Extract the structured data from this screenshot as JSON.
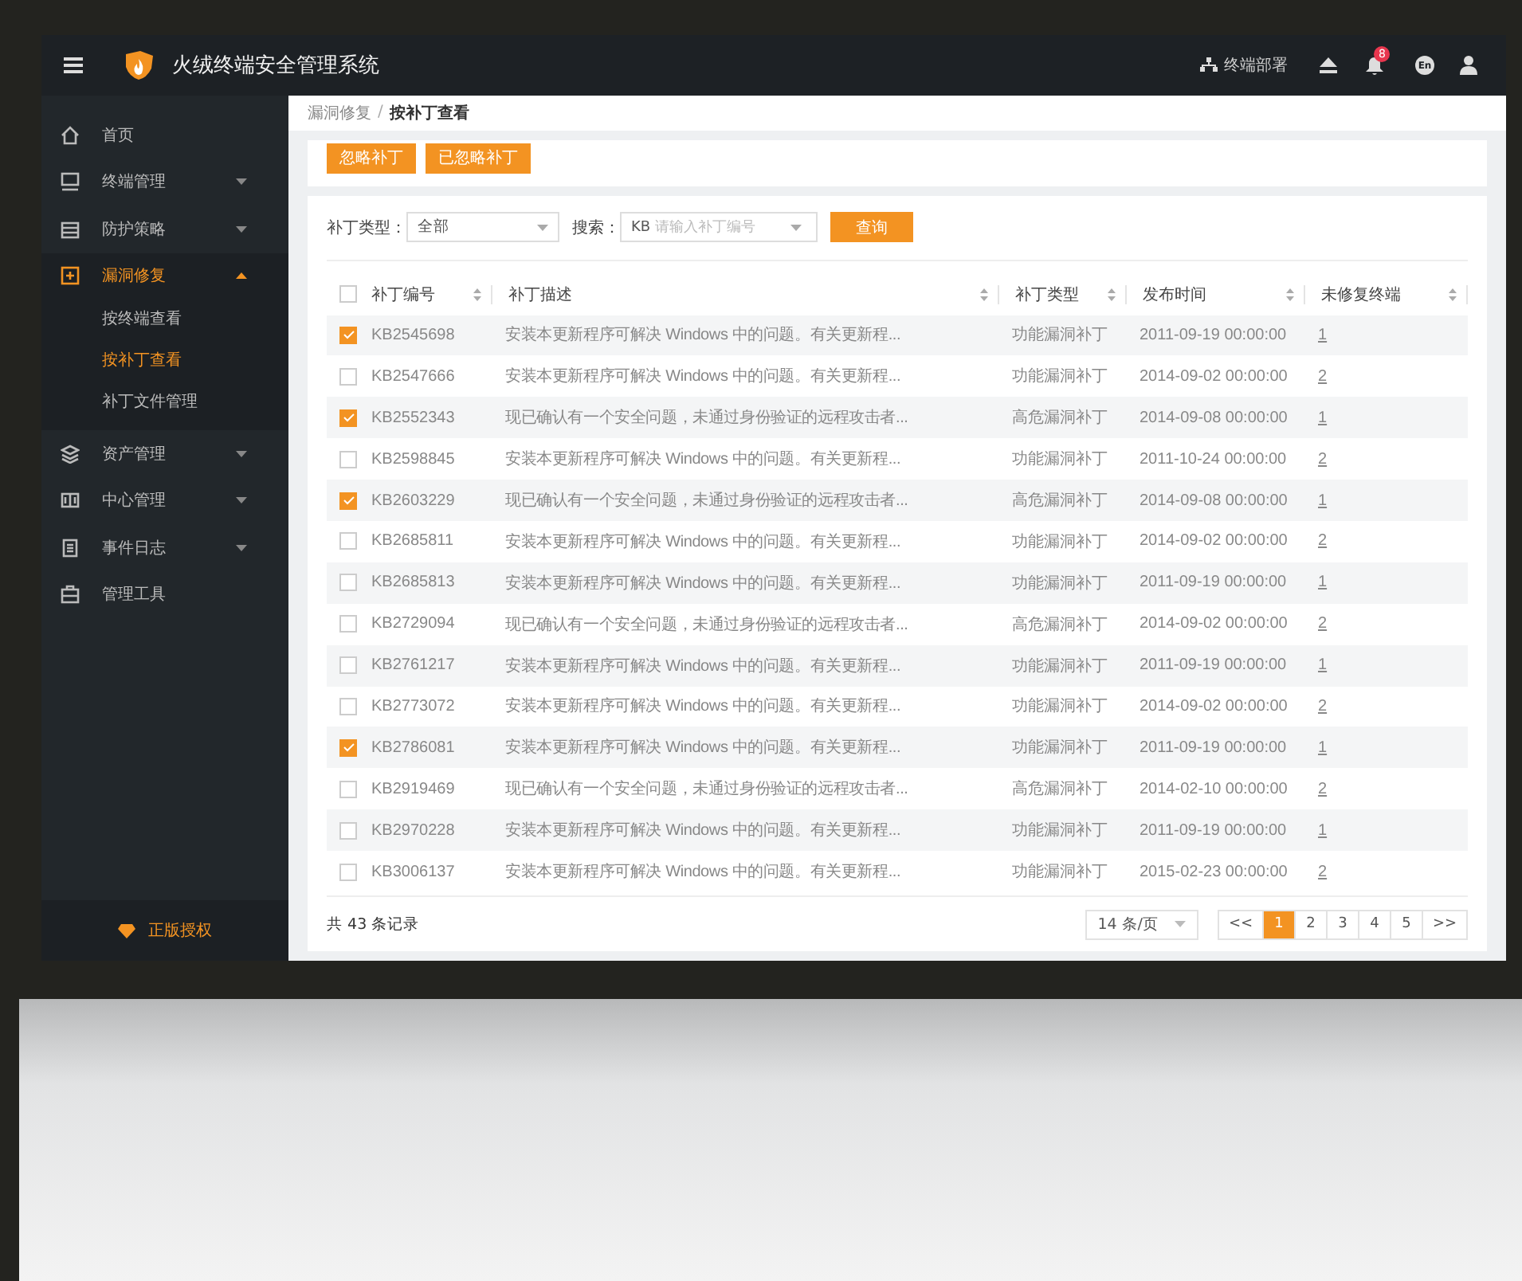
{
  "header": {
    "title": "火绒终端安全管理系统",
    "deploy": "终端部署",
    "notifications": "8",
    "language": "En"
  },
  "sidebar": {
    "items": [
      {
        "label": "首页",
        "expandable": false,
        "selected": false
      },
      {
        "label": "终端管理",
        "expandable": true,
        "expanded": false,
        "selected": false
      },
      {
        "label": "防护策略",
        "expandable": true,
        "expanded": false,
        "selected": false
      },
      {
        "label": "漏洞修复",
        "expandable": true,
        "expanded": true,
        "selected": true,
        "children": [
          {
            "label": "按终端查看",
            "selected": false
          },
          {
            "label": "按补丁查看",
            "selected": true
          },
          {
            "label": "补丁文件管理",
            "selected": false
          }
        ]
      },
      {
        "label": "资产管理",
        "expandable": true,
        "expanded": false,
        "selected": false
      },
      {
        "label": "中心管理",
        "expandable": true,
        "expanded": false,
        "selected": false
      },
      {
        "label": "事件日志",
        "expandable": true,
        "expanded": false,
        "selected": false
      },
      {
        "label": "管理工具",
        "expandable": false,
        "selected": false
      }
    ],
    "footer": "正版授权"
  },
  "breadcrumb": {
    "items": [
      "漏洞修复",
      "按补丁查看"
    ],
    "separator": "/"
  },
  "actions": [
    "忽略补丁",
    "已忽略补丁"
  ],
  "filters": {
    "type_label": "补丁类型：",
    "type_value": "全部",
    "search_label": "搜索：",
    "search_prefix": "KB",
    "search_placeholder": "请输入补丁编号",
    "query": "查询"
  },
  "table": {
    "all_checked": false,
    "columns": [
      "补丁编号",
      "补丁描述",
      "补丁类型",
      "发布时间",
      "未修复终端"
    ],
    "rows": [
      {
        "checked": true,
        "cells": [
          "KB2545698",
          "安装本更新程序可解决 Windows 中的问题。有关更新程...",
          "功能漏洞补丁",
          "2011-09-19 00:00:00",
          "1"
        ]
      },
      {
        "checked": false,
        "cells": [
          "KB2547666",
          "安装本更新程序可解决 Windows 中的问题。有关更新程...",
          "功能漏洞补丁",
          "2014-09-02 00:00:00",
          "2"
        ]
      },
      {
        "checked": true,
        "cells": [
          "KB2552343",
          "现已确认有一个安全问题，未通过身份验证的远程攻击者...",
          "高危漏洞补丁",
          "2014-09-08 00:00:00",
          "1"
        ]
      },
      {
        "checked": false,
        "cells": [
          "KB2598845",
          "安装本更新程序可解决 Windows 中的问题。有关更新程...",
          "功能漏洞补丁",
          "2011-10-24 00:00:00",
          "2"
        ]
      },
      {
        "checked": true,
        "cells": [
          "KB2603229",
          "现已确认有一个安全问题，未通过身份验证的远程攻击者...",
          "高危漏洞补丁",
          "2014-09-08 00:00:00",
          "1"
        ]
      },
      {
        "checked": false,
        "cells": [
          "KB2685811",
          "安装本更新程序可解决 Windows 中的问题。有关更新程...",
          "功能漏洞补丁",
          "2014-09-02 00:00:00",
          "2"
        ]
      },
      {
        "checked": false,
        "cells": [
          "KB2685813",
          "安装本更新程序可解决 Windows 中的问题。有关更新程...",
          "功能漏洞补丁",
          "2011-09-19 00:00:00",
          "1"
        ]
      },
      {
        "checked": false,
        "cells": [
          "KB2729094",
          "现已确认有一个安全问题，未通过身份验证的远程攻击者...",
          "高危漏洞补丁",
          "2014-09-02 00:00:00",
          "2"
        ]
      },
      {
        "checked": false,
        "cells": [
          "KB2761217",
          "安装本更新程序可解决 Windows 中的问题。有关更新程...",
          "功能漏洞补丁",
          "2011-09-19 00:00:00",
          "1"
        ]
      },
      {
        "checked": false,
        "cells": [
          "KB2773072",
          "安装本更新程序可解决 Windows 中的问题。有关更新程...",
          "功能漏洞补丁",
          "2014-09-02 00:00:00",
          "2"
        ]
      },
      {
        "checked": true,
        "cells": [
          "KB2786081",
          "安装本更新程序可解决 Windows 中的问题。有关更新程...",
          "功能漏洞补丁",
          "2011-09-19 00:00:00",
          "1"
        ]
      },
      {
        "checked": false,
        "cells": [
          "KB2919469",
          "现已确认有一个安全问题，未通过身份验证的远程攻击者...",
          "高危漏洞补丁",
          "2014-02-10 00:00:00",
          "2"
        ]
      },
      {
        "checked": false,
        "cells": [
          "KB2970228",
          "安装本更新程序可解决 Windows 中的问题。有关更新程...",
          "功能漏洞补丁",
          "2011-09-19 00:00:00",
          "1"
        ]
      },
      {
        "checked": false,
        "cells": [
          "KB3006137",
          "安装本更新程序可解决 Windows 中的问题。有关更新程...",
          "功能漏洞补丁",
          "2015-02-23 00:00:00",
          "2"
        ]
      }
    ]
  },
  "footer": {
    "total": "共 43 条记录",
    "page_size": "14 条/页",
    "first": "<<",
    "last": ">>",
    "pages": [
      {
        "label": "1",
        "selected": true
      },
      {
        "label": "2",
        "selected": false
      },
      {
        "label": "3",
        "selected": false
      },
      {
        "label": "4",
        "selected": false
      },
      {
        "label": "5",
        "selected": false
      }
    ]
  }
}
